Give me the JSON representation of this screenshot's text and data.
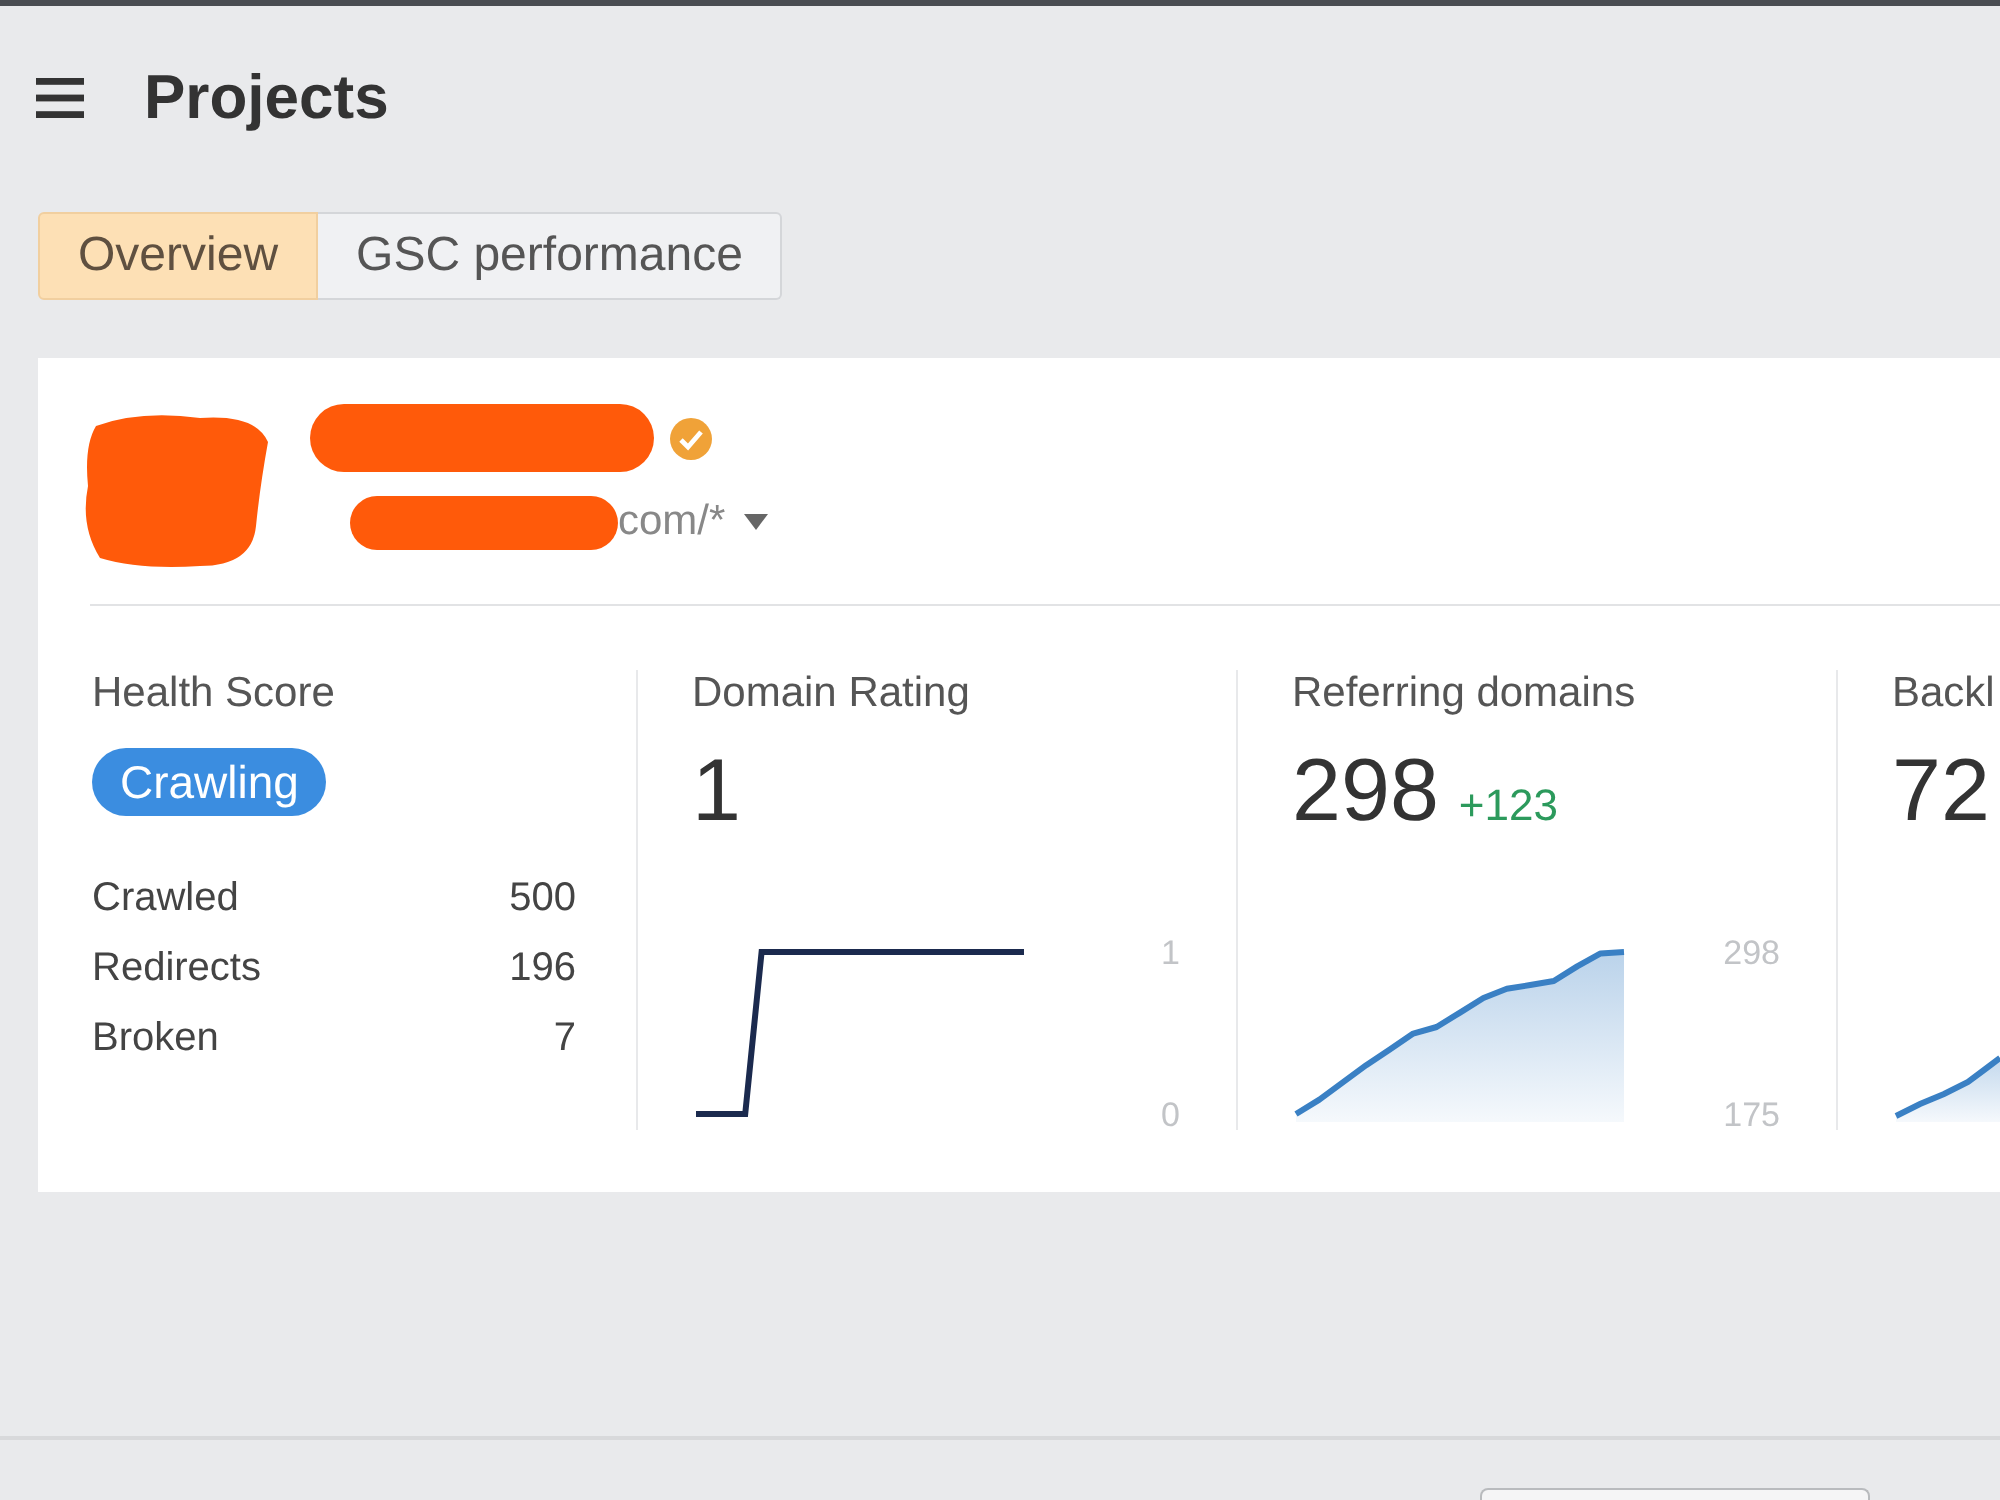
{
  "header": {
    "title": "Projects"
  },
  "tabs": [
    {
      "label": "Overview",
      "selected": true
    },
    {
      "label": "GSC performance",
      "selected": false
    }
  ],
  "project": {
    "avatar_redacted": true,
    "name_redacted": true,
    "url_redacted": true,
    "url_tail": "com/*",
    "verified": true
  },
  "metrics": [
    {
      "kind": "health",
      "label": "Health Score",
      "status": "Crawling",
      "stats": [
        {
          "label": "Crawled",
          "value": "500"
        },
        {
          "label": "Redirects",
          "value": "196"
        },
        {
          "label": "Broken",
          "value": "7"
        }
      ]
    },
    {
      "kind": "chart",
      "label": "Domain Rating",
      "value": "1",
      "chart_data": {
        "type": "line",
        "ylim": [
          0,
          1
        ],
        "yticks": [
          0,
          1
        ],
        "series": [
          {
            "color": "#1b2a4e",
            "values": [
              0,
              0,
              0,
              0,
              1,
              1,
              1,
              1,
              1,
              1,
              1,
              1,
              1,
              1,
              1,
              1,
              1,
              1,
              1,
              1,
              1
            ]
          }
        ]
      }
    },
    {
      "kind": "chart",
      "label": "Referring domains",
      "value": "298",
      "change": "+123",
      "chart_data": {
        "type": "area",
        "ylim": [
          175,
          298
        ],
        "yticks": [
          175,
          298
        ],
        "series": [
          {
            "color": "#3a80c4",
            "values": [
              175,
              186,
              199,
              212,
              224,
              236,
              241,
              252,
              263,
              270,
              273,
              276,
              287,
              297,
              298
            ]
          }
        ]
      }
    },
    {
      "kind": "sparkline",
      "label": "Backl",
      "value": "72"
    }
  ]
}
